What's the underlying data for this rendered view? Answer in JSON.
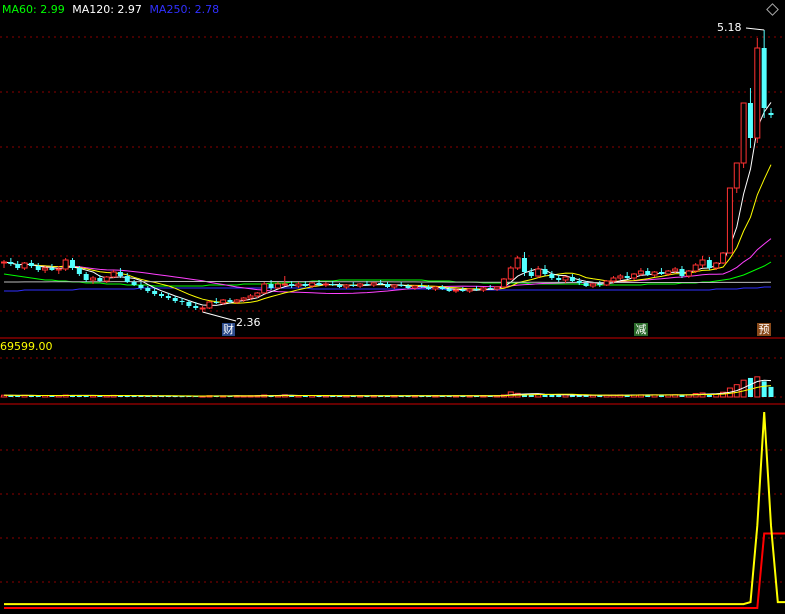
{
  "legend": {
    "ma60": {
      "label": "MA60: 2.99",
      "color": "#00ff00"
    },
    "ma120": {
      "label": "MA120: 2.97",
      "color": "#ffffff"
    },
    "ma250": {
      "label": "MA250: 2.78",
      "color": "#3030ff"
    }
  },
  "annotations": {
    "high_label": "5.18",
    "low_label": "2.36",
    "volume_label": "69599.00",
    "marker_cai": "财",
    "marker_jian": "减",
    "marker_yu": "预"
  },
  "colors": {
    "up": "#ff3232",
    "down": "#54ffff",
    "ma_short": "#ffffff",
    "ma_mid": "#ffff00",
    "ma_long": "#ff40ff",
    "grid": "#8b0000",
    "indicator_yellow": "#ffff00",
    "indicator_red": "#ff0000"
  },
  "chart_data": {
    "type": "candlestick",
    "price_ylim": [
      2.3,
      5.3
    ],
    "candles": [
      [
        2.85,
        2.88,
        2.8,
        2.86
      ],
      [
        2.86,
        2.9,
        2.82,
        2.84
      ],
      [
        2.84,
        2.87,
        2.78,
        2.8
      ],
      [
        2.8,
        2.86,
        2.78,
        2.85
      ],
      [
        2.85,
        2.88,
        2.8,
        2.82
      ],
      [
        2.82,
        2.85,
        2.76,
        2.78
      ],
      [
        2.78,
        2.82,
        2.75,
        2.8
      ],
      [
        2.8,
        2.84,
        2.77,
        2.78
      ],
      [
        2.78,
        2.82,
        2.74,
        2.79
      ],
      [
        2.79,
        2.9,
        2.77,
        2.88
      ],
      [
        2.88,
        2.9,
        2.78,
        2.8
      ],
      [
        2.8,
        2.82,
        2.72,
        2.74
      ],
      [
        2.74,
        2.76,
        2.66,
        2.68
      ],
      [
        2.68,
        2.72,
        2.64,
        2.7
      ],
      [
        2.7,
        2.73,
        2.66,
        2.67
      ],
      [
        2.67,
        2.72,
        2.65,
        2.71
      ],
      [
        2.71,
        2.78,
        2.7,
        2.76
      ],
      [
        2.76,
        2.8,
        2.7,
        2.72
      ],
      [
        2.72,
        2.75,
        2.65,
        2.66
      ],
      [
        2.66,
        2.68,
        2.62,
        2.63
      ],
      [
        2.63,
        2.66,
        2.58,
        2.6
      ],
      [
        2.6,
        2.62,
        2.55,
        2.57
      ],
      [
        2.57,
        2.6,
        2.52,
        2.54
      ],
      [
        2.54,
        2.56,
        2.5,
        2.52
      ],
      [
        2.52,
        2.55,
        2.48,
        2.5
      ],
      [
        2.5,
        2.52,
        2.45,
        2.47
      ],
      [
        2.47,
        2.5,
        2.43,
        2.46
      ],
      [
        2.46,
        2.48,
        2.4,
        2.42
      ],
      [
        2.42,
        2.46,
        2.38,
        2.4
      ],
      [
        2.4,
        2.42,
        2.36,
        2.4
      ],
      [
        2.4,
        2.47,
        2.39,
        2.46
      ],
      [
        2.46,
        2.5,
        2.44,
        2.45
      ],
      [
        2.45,
        2.49,
        2.43,
        2.48
      ],
      [
        2.48,
        2.5,
        2.45,
        2.46
      ],
      [
        2.46,
        2.49,
        2.44,
        2.48
      ],
      [
        2.48,
        2.51,
        2.46,
        2.5
      ],
      [
        2.5,
        2.54,
        2.48,
        2.52
      ],
      [
        2.52,
        2.56,
        2.5,
        2.55
      ],
      [
        2.55,
        2.66,
        2.54,
        2.64
      ],
      [
        2.64,
        2.68,
        2.58,
        2.6
      ],
      [
        2.6,
        2.66,
        2.59,
        2.64
      ],
      [
        2.64,
        2.72,
        2.62,
        2.64
      ],
      [
        2.64,
        2.67,
        2.6,
        2.62
      ],
      [
        2.62,
        2.66,
        2.6,
        2.64
      ],
      [
        2.64,
        2.67,
        2.61,
        2.62
      ],
      [
        2.62,
        2.66,
        2.6,
        2.65
      ],
      [
        2.65,
        2.68,
        2.62,
        2.63
      ],
      [
        2.63,
        2.66,
        2.61,
        2.64
      ],
      [
        2.64,
        2.67,
        2.62,
        2.63
      ],
      [
        2.63,
        2.65,
        2.6,
        2.61
      ],
      [
        2.61,
        2.64,
        2.59,
        2.63
      ],
      [
        2.63,
        2.66,
        2.61,
        2.62
      ],
      [
        2.62,
        2.65,
        2.6,
        2.64
      ],
      [
        2.64,
        2.67,
        2.62,
        2.63
      ],
      [
        2.63,
        2.66,
        2.61,
        2.65
      ],
      [
        2.65,
        2.68,
        2.63,
        2.64
      ],
      [
        2.64,
        2.66,
        2.6,
        2.61
      ],
      [
        2.61,
        2.64,
        2.59,
        2.63
      ],
      [
        2.63,
        2.66,
        2.61,
        2.62
      ],
      [
        2.62,
        2.64,
        2.59,
        2.6
      ],
      [
        2.6,
        2.63,
        2.58,
        2.62
      ],
      [
        2.62,
        2.65,
        2.6,
        2.61
      ],
      [
        2.61,
        2.63,
        2.58,
        2.59
      ],
      [
        2.59,
        2.62,
        2.57,
        2.61
      ],
      [
        2.61,
        2.63,
        2.58,
        2.59
      ],
      [
        2.59,
        2.61,
        2.56,
        2.57
      ],
      [
        2.57,
        2.6,
        2.55,
        2.58
      ],
      [
        2.58,
        2.61,
        2.56,
        2.57
      ],
      [
        2.57,
        2.6,
        2.55,
        2.59
      ],
      [
        2.59,
        2.62,
        2.57,
        2.58
      ],
      [
        2.58,
        2.61,
        2.56,
        2.6
      ],
      [
        2.6,
        2.63,
        2.58,
        2.59
      ],
      [
        2.59,
        2.62,
        2.57,
        2.61
      ],
      [
        2.61,
        2.7,
        2.6,
        2.69
      ],
      [
        2.69,
        2.82,
        2.68,
        2.8
      ],
      [
        2.8,
        2.92,
        2.78,
        2.9
      ],
      [
        2.9,
        2.96,
        2.72,
        2.76
      ],
      [
        2.76,
        2.8,
        2.7,
        2.72
      ],
      [
        2.72,
        2.82,
        2.7,
        2.79
      ],
      [
        2.79,
        2.83,
        2.72,
        2.74
      ],
      [
        2.74,
        2.77,
        2.68,
        2.7
      ],
      [
        2.7,
        2.73,
        2.66,
        2.68
      ],
      [
        2.68,
        2.72,
        2.65,
        2.71
      ],
      [
        2.71,
        2.74,
        2.66,
        2.67
      ],
      [
        2.67,
        2.7,
        2.63,
        2.65
      ],
      [
        2.65,
        2.67,
        2.61,
        2.62
      ],
      [
        2.62,
        2.65,
        2.6,
        2.64
      ],
      [
        2.64,
        2.67,
        2.61,
        2.63
      ],
      [
        2.63,
        2.68,
        2.62,
        2.67
      ],
      [
        2.67,
        2.72,
        2.65,
        2.7
      ],
      [
        2.7,
        2.74,
        2.68,
        2.72
      ],
      [
        2.72,
        2.76,
        2.69,
        2.7
      ],
      [
        2.7,
        2.75,
        2.68,
        2.74
      ],
      [
        2.74,
        2.8,
        2.72,
        2.77
      ],
      [
        2.77,
        2.8,
        2.72,
        2.73
      ],
      [
        2.73,
        2.77,
        2.71,
        2.76
      ],
      [
        2.76,
        2.8,
        2.73,
        2.74
      ],
      [
        2.74,
        2.78,
        2.72,
        2.77
      ],
      [
        2.77,
        2.81,
        2.75,
        2.79
      ],
      [
        2.79,
        2.82,
        2.7,
        2.72
      ],
      [
        2.72,
        2.78,
        2.7,
        2.77
      ],
      [
        2.77,
        2.85,
        2.75,
        2.83
      ],
      [
        2.83,
        2.92,
        2.8,
        2.88
      ],
      [
        2.88,
        2.91,
        2.78,
        2.8
      ],
      [
        2.8,
        2.86,
        2.78,
        2.85
      ],
      [
        2.85,
        2.96,
        2.84,
        2.95
      ],
      [
        2.95,
        3.6,
        2.95,
        3.6
      ],
      [
        3.6,
        3.85,
        3.55,
        3.85
      ],
      [
        3.85,
        4.45,
        3.8,
        4.45
      ],
      [
        4.45,
        4.6,
        4.0,
        4.1
      ],
      [
        4.1,
        5.1,
        4.05,
        5.0
      ],
      [
        5.0,
        5.18,
        4.3,
        4.4
      ],
      [
        4.35,
        4.4,
        4.3,
        4.33
      ]
    ],
    "volume_ylim": [
      0,
      69599
    ],
    "volumes": [
      3200,
      2800,
      2500,
      3000,
      2600,
      2400,
      2700,
      2300,
      2600,
      3400,
      3000,
      2800,
      2600,
      2400,
      2300,
      2500,
      2900,
      2600,
      2400,
      2200,
      2100,
      2000,
      1900,
      1800,
      1900,
      1700,
      1600,
      1800,
      1700,
      1600,
      2400,
      2100,
      2000,
      1900,
      2100,
      2000,
      2200,
      2400,
      3500,
      2600,
      2500,
      3800,
      2400,
      2300,
      2200,
      2600,
      2300,
      2400,
      2200,
      2100,
      2300,
      2200,
      2400,
      2300,
      2500,
      2400,
      2200,
      2300,
      2200,
      2100,
      2300,
      2200,
      2100,
      2300,
      2200,
      2000,
      2100,
      2000,
      2200,
      2100,
      2300,
      2200,
      2400,
      3600,
      9000,
      6500,
      5200,
      4800,
      4600,
      4200,
      3800,
      3400,
      3600,
      3200,
      3000,
      2800,
      3000,
      2900,
      3300,
      3500,
      3700,
      3500,
      3600,
      3900,
      3700,
      3800,
      3700,
      3800,
      4000,
      3500,
      3900,
      6200,
      7200,
      5600,
      5300,
      8500,
      16000,
      22000,
      30000,
      34000,
      36000,
      28000,
      18000
    ],
    "indicator_ylim": [
      0,
      100
    ],
    "indicator_yellow": {
      "start_index": 0,
      "values": [
        2,
        2,
        2,
        2,
        2,
        2,
        2,
        2,
        2,
        2,
        2,
        2,
        2,
        2,
        2,
        2,
        2,
        2,
        2,
        2,
        2,
        2,
        2,
        2,
        2,
        2,
        2,
        2,
        2,
        2,
        2,
        2,
        2,
        2,
        2,
        2,
        2,
        2,
        2,
        2,
        2,
        2,
        2,
        2,
        2,
        2,
        2,
        2,
        2,
        2,
        2,
        2,
        2,
        2,
        2,
        2,
        2,
        2,
        2,
        2,
        2,
        2,
        2,
        2,
        2,
        2,
        2,
        2,
        2,
        2,
        2,
        2,
        2,
        2,
        2,
        2,
        2,
        2,
        2,
        2,
        2,
        2,
        2,
        2,
        2,
        2,
        2,
        2,
        2,
        2,
        2,
        2,
        2,
        2,
        2,
        2,
        2,
        2,
        2,
        2,
        2,
        2,
        2,
        2,
        2,
        2,
        2,
        2,
        2,
        3,
        42,
        100,
        42,
        3,
        3,
        3,
        3
      ]
    },
    "indicator_red": {
      "start_index": 0,
      "values": [
        0,
        0,
        0,
        0,
        0,
        0,
        0,
        0,
        0,
        0,
        0,
        0,
        0,
        0,
        0,
        0,
        0,
        0,
        0,
        0,
        0,
        0,
        0,
        0,
        0,
        0,
        0,
        0,
        0,
        0,
        0,
        0,
        0,
        0,
        0,
        0,
        0,
        0,
        0,
        0,
        0,
        0,
        0,
        0,
        0,
        0,
        0,
        0,
        0,
        0,
        0,
        0,
        0,
        0,
        0,
        0,
        0,
        0,
        0,
        0,
        0,
        0,
        0,
        0,
        0,
        0,
        0,
        0,
        0,
        0,
        0,
        0,
        0,
        0,
        0,
        0,
        0,
        0,
        0,
        0,
        0,
        0,
        0,
        0,
        0,
        0,
        0,
        0,
        0,
        0,
        0,
        0,
        0,
        0,
        0,
        0,
        0,
        0,
        0,
        0,
        0,
        0,
        0,
        0,
        0,
        0,
        0,
        0,
        0,
        0,
        0,
        38,
        38,
        38,
        38,
        38,
        0
      ]
    },
    "ma_levels": {
      "ma60": [
        2.74,
        2.73,
        2.72,
        2.71,
        2.7,
        2.69,
        2.68,
        2.68,
        2.67,
        2.67,
        2.66,
        2.66,
        2.65,
        2.65,
        2.65,
        2.64,
        2.64,
        2.64,
        2.63,
        2.63,
        2.63,
        2.63,
        2.62,
        2.62,
        2.62,
        2.62,
        2.62,
        2.62,
        2.62,
        2.62,
        2.63,
        2.63,
        2.63,
        2.63,
        2.63,
        2.64,
        2.64,
        2.64,
        2.64,
        2.65,
        2.65,
        2.65,
        2.66,
        2.66,
        2.66,
        2.67,
        2.67,
        2.67,
        2.67,
        2.68,
        2.68,
        2.68,
        2.68,
        2.68,
        2.68,
        2.68,
        2.68,
        2.68,
        2.68,
        2.68,
        2.68,
        2.68,
        2.67,
        2.67,
        2.67,
        2.67,
        2.66,
        2.66,
        2.66,
        2.66,
        2.65,
        2.65,
        2.65,
        2.65,
        2.65,
        2.65,
        2.65,
        2.64,
        2.64,
        2.64,
        2.64,
        2.64,
        2.64,
        2.64,
        2.64,
        2.63,
        2.63,
        2.63,
        2.63,
        2.63,
        2.63,
        2.63,
        2.63,
        2.63,
        2.64,
        2.64,
        2.64,
        2.64,
        2.64,
        2.65,
        2.65,
        2.65,
        2.66,
        2.66,
        2.67,
        2.68,
        2.69,
        2.71,
        2.73,
        2.76,
        2.79,
        2.82,
        2.86
      ],
      "ma250": [
        2.57,
        2.57,
        2.57,
        2.58,
        2.58,
        2.58,
        2.58,
        2.58,
        2.58,
        2.58,
        2.58,
        2.59,
        2.59,
        2.59,
        2.59,
        2.59,
        2.59,
        2.59,
        2.59,
        2.59,
        2.6,
        2.6,
        2.6,
        2.6,
        2.6,
        2.6,
        2.6,
        2.6,
        2.6,
        2.6,
        2.6,
        2.6,
        2.6,
        2.6,
        2.6,
        2.6,
        2.6,
        2.6,
        2.6,
        2.6,
        2.6,
        2.6,
        2.6,
        2.6,
        2.6,
        2.59,
        2.59,
        2.59,
        2.59,
        2.59,
        2.59,
        2.59,
        2.59,
        2.59,
        2.59,
        2.59,
        2.59,
        2.59,
        2.59,
        2.59,
        2.59,
        2.59,
        2.59,
        2.59,
        2.59,
        2.58,
        2.58,
        2.58,
        2.58,
        2.58,
        2.58,
        2.58,
        2.58,
        2.58,
        2.58,
        2.58,
        2.58,
        2.58,
        2.58,
        2.58,
        2.58,
        2.58,
        2.58,
        2.58,
        2.58,
        2.58,
        2.58,
        2.58,
        2.58,
        2.58,
        2.58,
        2.58,
        2.58,
        2.58,
        2.58,
        2.58,
        2.58,
        2.58,
        2.58,
        2.58,
        2.58,
        2.58,
        2.58,
        2.58,
        2.59,
        2.59,
        2.59,
        2.59,
        2.6,
        2.6,
        2.6,
        2.61,
        2.61
      ]
    }
  }
}
